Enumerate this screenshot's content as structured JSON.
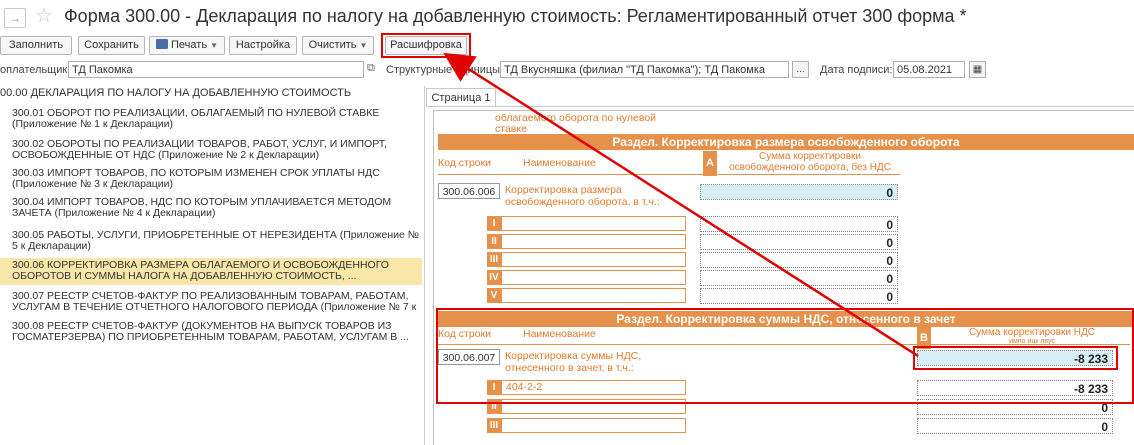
{
  "window": {
    "title": "Форма 300.00 - Декларация по налогу на добавленную стоимость: Регламентированный отчет 300 форма *",
    "nav_forward_icon": "arrow-right-icon",
    "favorite_icon": "star-icon"
  },
  "toolbar": {
    "fill": "Заполнить",
    "save": "Сохранить",
    "print": "Печать",
    "settings": "Настройка",
    "clear": "Очистить",
    "decode": "Расшифровка"
  },
  "fields": {
    "taxpayer_label": "оплательщик:",
    "taxpayer_value": "ТД Пакомка",
    "units_label": "Структурные единицы:",
    "units_value": "ТД Вкусняшка (филиал \"ТД Пакомка\"); ТД Пакомка",
    "units_btn": "...",
    "sign_date_label": "Дата подписи:",
    "sign_date_value": "05.08.2021"
  },
  "tree": {
    "root": "00.00 ДЕКЛАРАЦИЯ ПО НАЛОГУ НА ДОБАВЛЕННУЮ СТОИМОСТЬ",
    "items": [
      {
        "l1": "300.01 ОБОРОТ ПО РЕАЛИЗАЦИИ, ОБЛАГАЕМЫЙ ПО НУЛЕВОЙ СТАВКЕ",
        "l2": "(Приложение № 1 к Декларации)"
      },
      {
        "l1": "300.02 ОБОРОТЫ ПО  РЕАЛИЗАЦИИ ТОВАРОВ, РАБОТ, УСЛУГ, И ИМПОРТ,",
        "l2": "ОСВОБОЖДЕННЫЕ ОТ НДС (Приложение № 2 к Декларации)"
      },
      {
        "l1": "300.03 ИМПОРТ ТОВАРОВ, ПО КОТОРЫМ ИЗМЕНЕН СРОК УПЛАТЫ НДС",
        "l2": "(Приложение № 3 к Декларации)"
      },
      {
        "l1": "300.04 ИМПОРТ ТОВАРОВ, НДС ПО КОТОРЫМ УПЛАЧИВАЕТСЯ МЕТОДОМ",
        "l2": "ЗАЧЕТА (Приложение № 4 к Декларации)"
      },
      {
        "l1": "300.05 РАБОТЫ, УСЛУГИ, ПРИОБРЕТЕННЫЕ ОТ НЕРЕЗИДЕНТА (Приложение №",
        "l2": "5 к Декларации)"
      },
      {
        "l1": "300.06 КОРРЕКТИРОВКА РАЗМЕРА ОБЛАГАЕМОГО И ОСВОБОЖДЕННОГО",
        "l2": "ОБОРОТОВ И СУММЫ НАЛОГА НА ДОБАВЛЕННУЮ СТОИМОСТЬ, ..."
      },
      {
        "l1": "300.07 РЕЕСТР СЧЕТОВ-ФАКТУР ПО РЕАЛИЗОВАННЫМ ТОВАРАМ, РАБОТАМ,",
        "l2": "УСЛУГАМ В ТЕЧЕНИЕ ОТЧЕТНОГО НАЛОГОВОГО ПЕРИОДА (Приложение № 7 к"
      },
      {
        "l1": "300.08 РЕЕСТР СЧЕТОВ-ФАКТУР (ДОКУМЕНТОВ НА ВЫПУСК ТОВАРОВ ИЗ",
        "l2": "ГОСМАТЕРЗЕРВА) ПО ПРИОБРЕТЕННЫМ ТОВАРАМ, РАБОТАМ, УСЛУГАМ В ..."
      }
    ]
  },
  "form": {
    "tab": "Страница 1",
    "prev_text1": "облагаемого оборота по нулевой",
    "prev_text2": "ставке",
    "section1": {
      "title": "Раздел. Корректировка размера освобожденного оборота",
      "col_code": "Код строки",
      "col_name": "Наименование",
      "col_letter": "A",
      "col_sum1": "Сумма корректировки",
      "col_sum2": "освобожденного оборота, без НДС",
      "row_code": "300.06.006",
      "row_name1": "Корректировка размера",
      "row_name2": "освобожденного оборота, в т.ч.:",
      "row_value": "0",
      "subrows": [
        {
          "roman": "I",
          "value": "0"
        },
        {
          "roman": "II",
          "value": "0"
        },
        {
          "roman": "III",
          "value": "0"
        },
        {
          "roman": "IV",
          "value": "0"
        },
        {
          "roman": "V",
          "value": "0"
        }
      ]
    },
    "section2": {
      "title": "Раздел. Корректировка суммы НДС, отнесенного в зачет",
      "col_code": "Код строки",
      "col_name": "Наименование",
      "col_letter": "B",
      "col_sum": "Сумма корректировки НДС",
      "col_sub": "импо          ицк          лвус",
      "row_code": "300.06.007",
      "row_name1": "Корректировка суммы НДС,",
      "row_name2": "отнесенного в зачет, в т.ч.:",
      "row_value": "-8 233",
      "subrows": [
        {
          "roman": "I",
          "text": "404-2-2",
          "value": "-8 233"
        },
        {
          "roman": "II",
          "text": "",
          "value": "0"
        },
        {
          "roman": "III",
          "text": "",
          "value": "0"
        }
      ]
    }
  },
  "colors": {
    "accent_orange": "#e6914b",
    "highlight_red": "#e00000",
    "selected_row": "#f8e7a8",
    "value_highlight": "#d7eef5"
  }
}
